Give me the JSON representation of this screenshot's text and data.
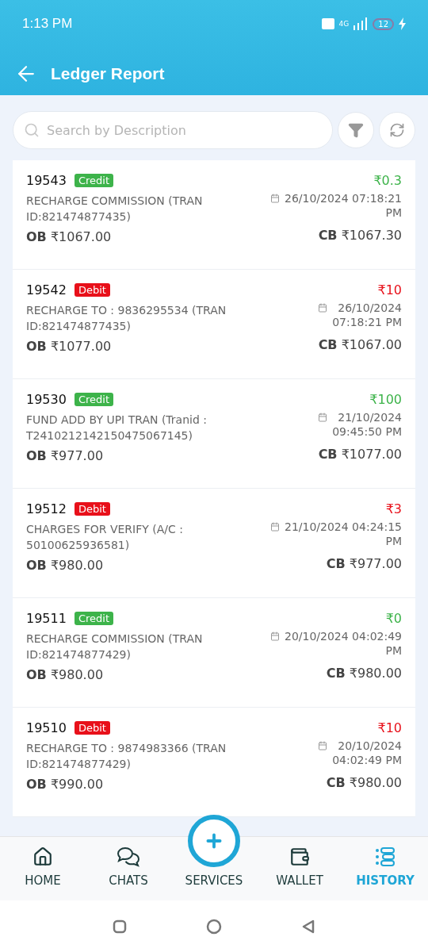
{
  "status_bar": {
    "time": "1:13 PM",
    "network": "4G",
    "battery": "12"
  },
  "header": {
    "title": "Ledger Report"
  },
  "search": {
    "placeholder": "Search by Description"
  },
  "entries": [
    {
      "id": "19543",
      "kind": "credit",
      "badge": "Credit",
      "description": "RECHARGE COMMISSION (TRAN ID:821474877435)",
      "amount": "₹0.3",
      "date_lines": [
        "26/10/2024 07:18:21",
        "PM"
      ],
      "ob_label": "OB",
      "ob": "₹1067.00",
      "cb_label": "CB",
      "cb": "₹1067.30"
    },
    {
      "id": "19542",
      "kind": "debit",
      "badge": "Debit",
      "description": "RECHARGE TO : 9836295534 (TRAN ID:821474877435)",
      "amount": "₹10",
      "date_lines": [
        "26/10/2024",
        "07:18:21 PM"
      ],
      "ob_label": "OB",
      "ob": "₹1077.00",
      "cb_label": "CB",
      "cb": "₹1067.00"
    },
    {
      "id": "19530",
      "kind": "credit",
      "badge": "Credit",
      "description": "FUND ADD BY UPI TRAN (Tranid : T2410212142150475067145)",
      "amount": "₹100",
      "date_lines": [
        "21/10/2024",
        "09:45:50 PM"
      ],
      "ob_label": "OB",
      "ob": "₹977.00",
      "cb_label": "CB",
      "cb": "₹1077.00"
    },
    {
      "id": "19512",
      "kind": "debit",
      "badge": "Debit",
      "description": "CHARGES FOR VERIFY (A/C : 50100625936581)",
      "amount": "₹3",
      "date_lines": [
        "21/10/2024 04:24:15",
        "PM"
      ],
      "ob_label": "OB",
      "ob": "₹980.00",
      "cb_label": "CB",
      "cb": "₹977.00"
    },
    {
      "id": "19511",
      "kind": "credit",
      "badge": "Credit",
      "description": "RECHARGE COMMISSION (TRAN ID:821474877429)",
      "amount": "₹0",
      "date_lines": [
        "20/10/2024 04:02:49",
        "PM"
      ],
      "ob_label": "OB",
      "ob": "₹980.00",
      "cb_label": "CB",
      "cb": "₹980.00"
    },
    {
      "id": "19510",
      "kind": "debit",
      "badge": "Debit",
      "description": "RECHARGE TO : 9874983366 (TRAN ID:821474877429)",
      "amount": "₹10",
      "date_lines": [
        "20/10/2024",
        "04:02:49 PM"
      ],
      "ob_label": "OB",
      "ob": "₹990.00",
      "cb_label": "CB",
      "cb": "₹980.00"
    }
  ],
  "bottom_nav": [
    {
      "kind": "home",
      "label": "HOME",
      "selected": false
    },
    {
      "kind": "chats",
      "label": "CHATS",
      "selected": false
    },
    {
      "kind": "services",
      "label": "SERVICES",
      "selected": false
    },
    {
      "kind": "wallet",
      "label": "WALLET",
      "selected": false
    },
    {
      "kind": "history",
      "label": "HISTORY",
      "selected": true
    }
  ]
}
